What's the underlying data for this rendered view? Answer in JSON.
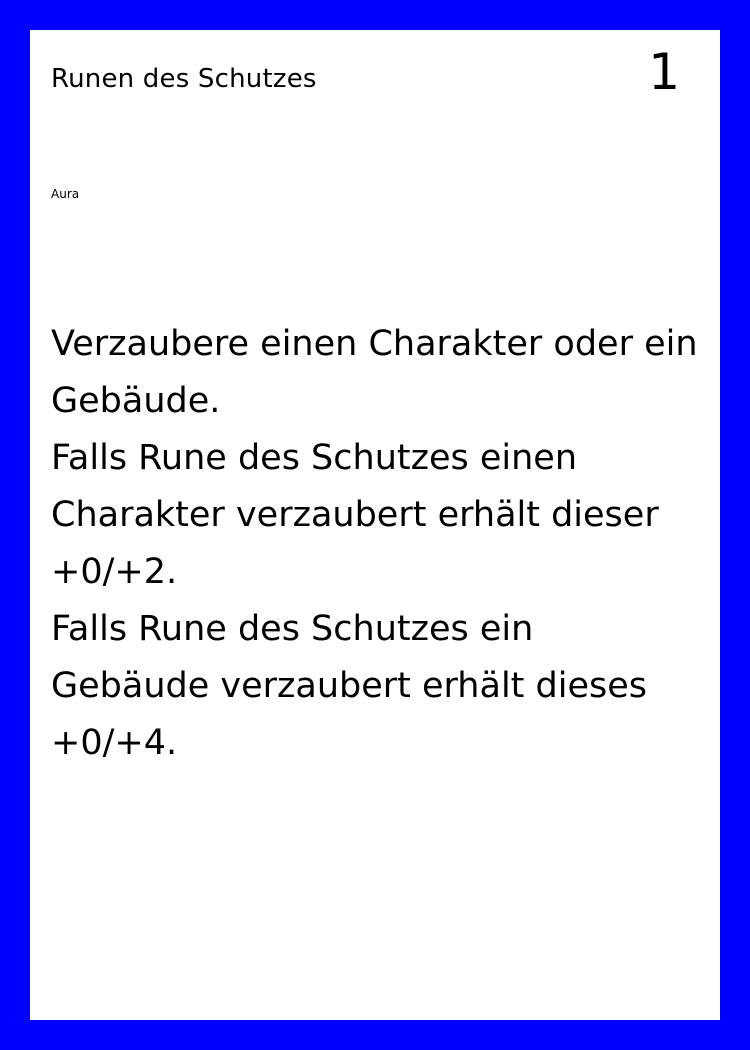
{
  "card": {
    "title": "Runen des Schutzes",
    "cost": "1",
    "type": "Aura",
    "text_lines": [
      "Verzaubere einen Charakter oder ein Gebäude.",
      "Falls Rune des Schutzes einen Charakter verzaubert erhält dieser +0/+2.",
      "Falls Rune des Schutzes ein Gebäude verzaubert erhält dieses +0/+4."
    ]
  },
  "colors": {
    "border": "#0000ff",
    "background": "#ffffff",
    "text": "#000000"
  }
}
